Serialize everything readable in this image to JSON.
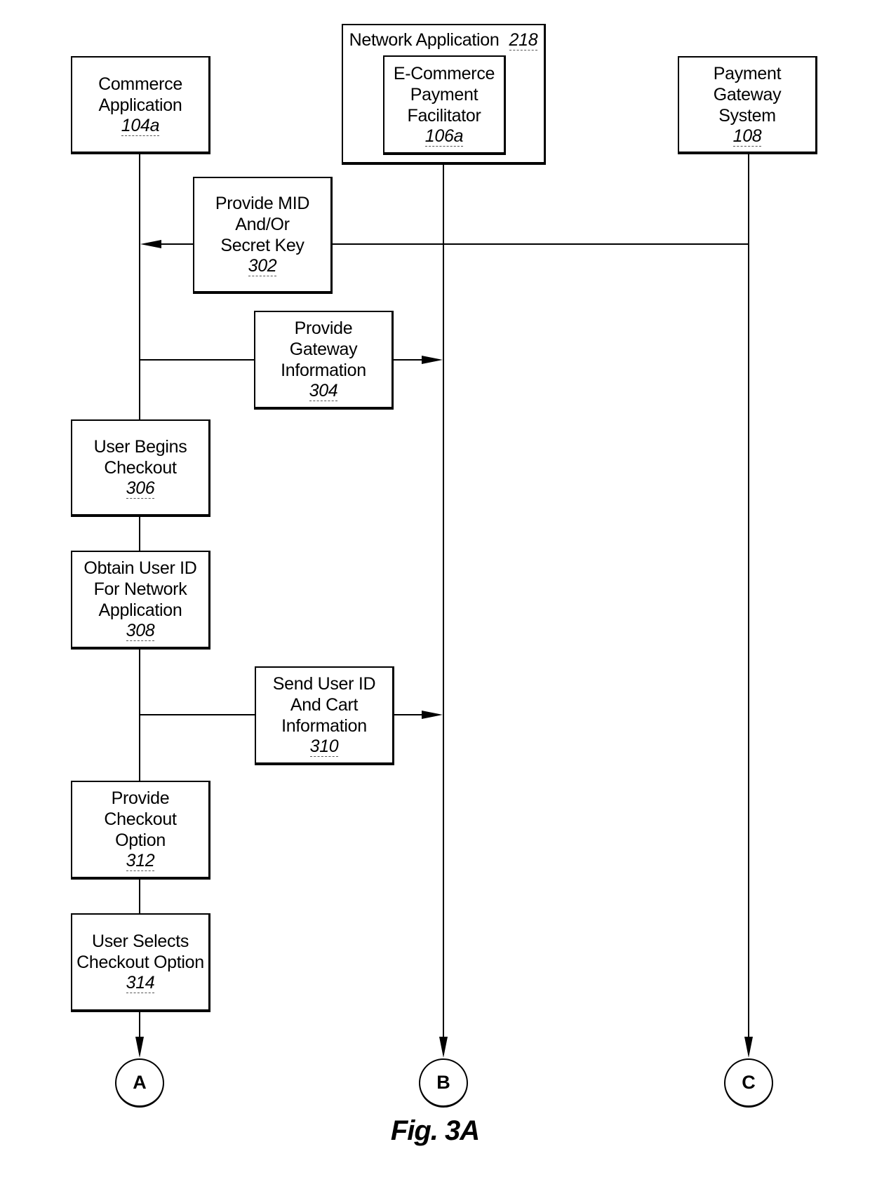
{
  "figure": {
    "label": "Fig. 3A",
    "lifelines": [
      {
        "id": "commerce-application",
        "lines": [
          "Commerce",
          "Application"
        ],
        "ref": "104a"
      },
      {
        "id": "network-application",
        "title": "Network Application",
        "ref": "218",
        "inner": {
          "lines": [
            "E-Commerce",
            "Payment",
            "Facilitator"
          ],
          "ref": "106a"
        }
      },
      {
        "id": "payment-gateway-system",
        "lines": [
          "Payment",
          "Gateway",
          "System"
        ],
        "ref": "108"
      }
    ],
    "steps": [
      {
        "ref": "302",
        "lines": [
          "Provide MID",
          "And/Or",
          "Secret Key"
        ],
        "from": "Payment Gateway System",
        "to": "Commerce Application"
      },
      {
        "ref": "304",
        "lines": [
          "Provide",
          "Gateway",
          "Information"
        ],
        "from": "Commerce Application",
        "to": "E-Commerce Payment Facilitator"
      },
      {
        "ref": "306",
        "lines": [
          "User Begins",
          "Checkout"
        ],
        "on": "Commerce Application"
      },
      {
        "ref": "308",
        "lines": [
          "Obtain User ID",
          "For Network",
          "Application"
        ],
        "on": "Commerce Application"
      },
      {
        "ref": "310",
        "lines": [
          "Send User ID",
          "And Cart",
          "Information"
        ],
        "from": "Commerce Application",
        "to": "E-Commerce Payment Facilitator"
      },
      {
        "ref": "312",
        "lines": [
          "Provide",
          "Checkout",
          "Option"
        ],
        "on": "Commerce Application"
      },
      {
        "ref": "314",
        "lines": [
          "User Selects",
          "Checkout Option"
        ],
        "on": "Commerce Application"
      }
    ],
    "connectors": [
      "A",
      "B",
      "C"
    ]
  }
}
